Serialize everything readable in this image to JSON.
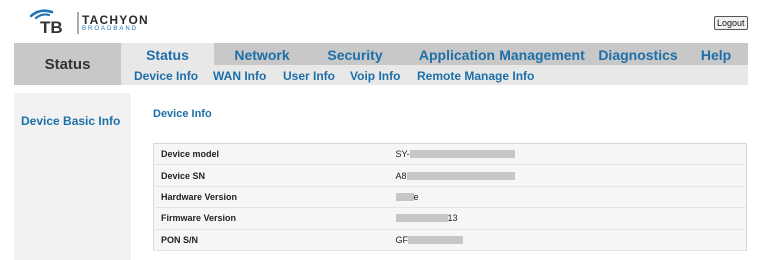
{
  "brand": {
    "logo_mark": "TB",
    "name": "TACHYON",
    "tagline": "BROADBAND"
  },
  "header": {
    "logout_label": "Logout"
  },
  "nav": {
    "status_label": "Status",
    "tabs": [
      {
        "label": "Status",
        "active": true
      },
      {
        "label": "Network",
        "active": false
      },
      {
        "label": "Security",
        "active": false
      },
      {
        "label": "Application",
        "active": false
      },
      {
        "label": "Management",
        "active": false
      },
      {
        "label": "Diagnostics",
        "active": false
      },
      {
        "label": "Help",
        "active": false
      }
    ],
    "subtabs": [
      {
        "label": "Device Info",
        "active": true
      },
      {
        "label": "WAN Info",
        "active": false
      },
      {
        "label": "User Info",
        "active": false
      },
      {
        "label": "Voip Info",
        "active": false
      },
      {
        "label": "Remote Manage Info",
        "active": false
      }
    ]
  },
  "sidebar": {
    "items": [
      {
        "label": "Device Basic Info",
        "active": true
      }
    ]
  },
  "content": {
    "title": "Device Info",
    "rows": [
      {
        "label": "Device model",
        "value_prefix": "SY-",
        "value_suffix": "",
        "redacted": true
      },
      {
        "label": "Device SN",
        "value_prefix": "A8",
        "value_suffix": "",
        "redacted": true
      },
      {
        "label": "Hardware Version",
        "value_prefix": "",
        "value_suffix": "e",
        "redacted": true
      },
      {
        "label": "Firmware Version",
        "value_prefix": "",
        "value_suffix": "13",
        "redacted": true
      },
      {
        "label": "PON S/N",
        "value_prefix": "GF",
        "value_suffix": "",
        "redacted": true
      }
    ]
  },
  "colors": {
    "link_blue": "#1d6fa8",
    "nav_gray": "#c8c8c8",
    "subnav_gray": "#e8e8e8",
    "panel_gray": "#f2f2f2",
    "redaction_gray": "#c6c6c6"
  },
  "icons": {
    "logo": "tb-signal-logo-icon"
  }
}
